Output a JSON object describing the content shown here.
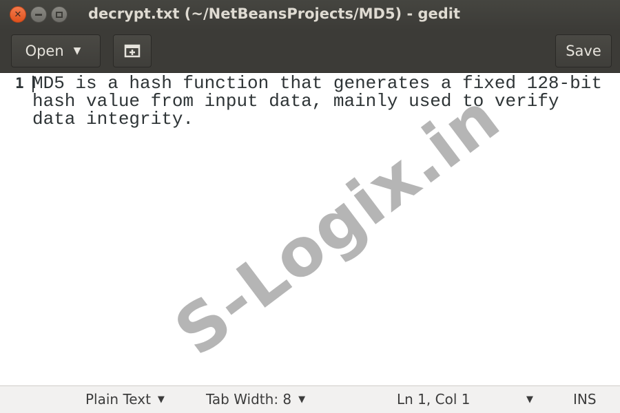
{
  "window": {
    "title": "decrypt.txt (~/NetBeansProjects/MD5) - gedit",
    "close_glyph": "✕"
  },
  "toolbar": {
    "open_label": "Open",
    "open_arrow": "▼",
    "new_tab_glyph": "⊞",
    "save_label": "Save"
  },
  "editor": {
    "line_number": "1",
    "content": "MD5 is a hash function that generates a fixed 128-bit hash value from input data, mainly used to verify data integrity."
  },
  "watermark": "S-Logix.in",
  "statusbar": {
    "language": "Plain Text",
    "tab_width": "Tab Width: 8",
    "position": "Ln 1, Col 1",
    "mode": "INS",
    "arrow": "▼"
  }
}
